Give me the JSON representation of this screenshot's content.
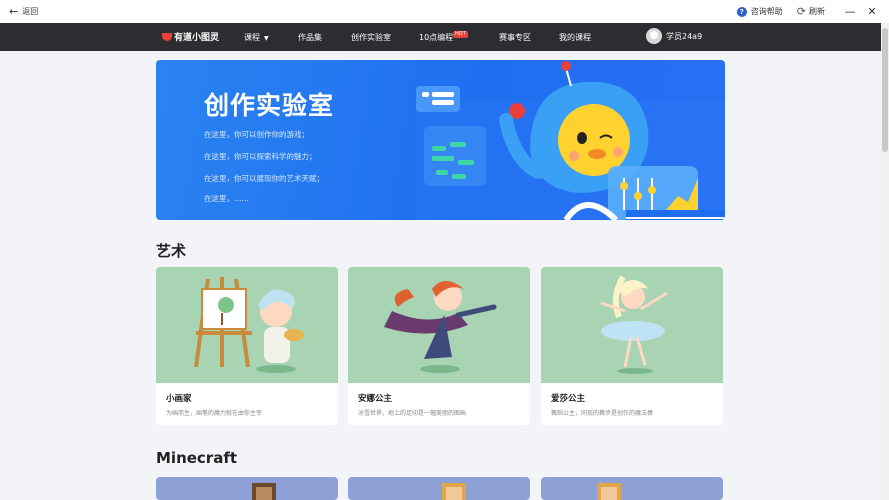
{
  "titlebar": {
    "back_label": "返回",
    "help_label": "咨询帮助",
    "refresh_label": "刷新"
  },
  "nav": {
    "logo": "有道小图灵",
    "items": [
      {
        "label": "课程"
      },
      {
        "label": "作品集"
      },
      {
        "label": "创作实验室"
      },
      {
        "label": "10点编程",
        "badge": "HOT"
      },
      {
        "label": "赛事专区"
      },
      {
        "label": "我的课程"
      }
    ],
    "username": "学员24a9"
  },
  "banner": {
    "title": "创作实验室",
    "lines": [
      "在这里，你可以创作你的游戏；",
      "在这里，你可以探索科学的魅力；",
      "在这里，你可以展现你的艺术天赋；",
      "在这里，……"
    ]
  },
  "sections": [
    {
      "title": "艺术",
      "cards": [
        {
          "title": "小画家",
          "desc": "为画而生，画笔的魔力就在由你主宰"
        },
        {
          "title": "安娜公主",
          "desc": "冰雪世界，地上的足印是一幅美丽的图画"
        },
        {
          "title": "爱莎公主",
          "desc": "舞蹈公主，同现的舞步是创作的魔法棒"
        }
      ]
    },
    {
      "title": "Minecraft"
    }
  ],
  "colors": {
    "navbar": "#2c2d31",
    "banner": "#1f6ef0",
    "card_art_bg": "#a8d4b4",
    "minecraft_bg": "#8da1d6",
    "hot_badge": "#e8413c"
  }
}
